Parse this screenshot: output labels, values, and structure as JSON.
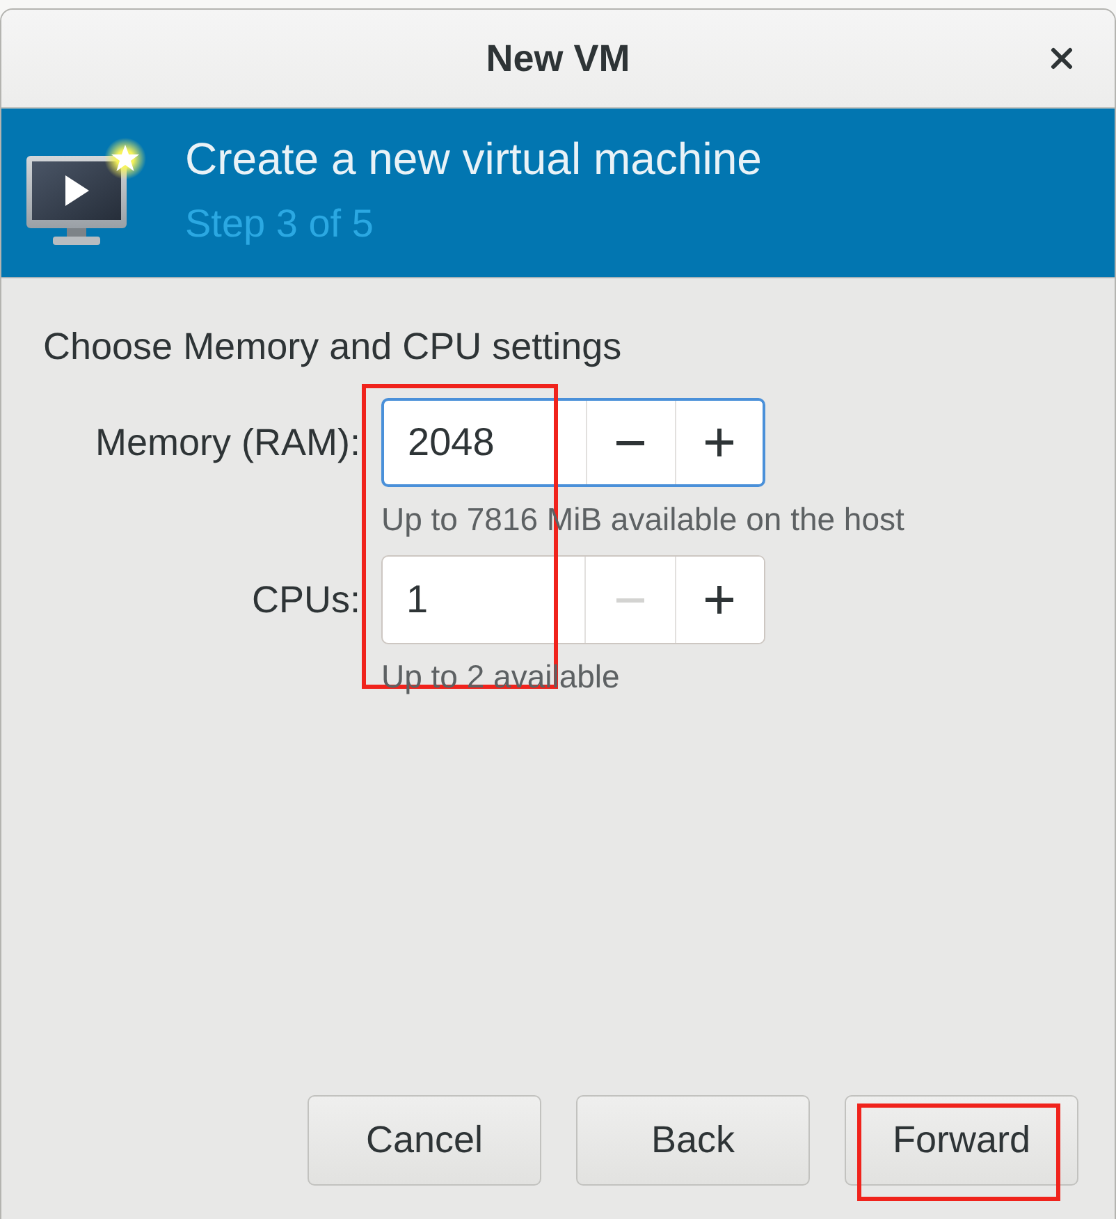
{
  "window": {
    "title": "New VM"
  },
  "banner": {
    "title": "Create a new virtual machine",
    "step": "Step 3 of 5"
  },
  "section": {
    "heading": "Choose Memory and CPU settings"
  },
  "fields": [
    {
      "label": "Memory (RAM):",
      "value": "2048",
      "focused": true,
      "decrement_disabled": false,
      "increment_disabled": false,
      "hint": "Up to 7816 MiB available on the host"
    },
    {
      "label": "CPUs:",
      "value": "1",
      "focused": false,
      "decrement_disabled": true,
      "increment_disabled": false,
      "hint": "Up to 2 available"
    }
  ],
  "buttons": [
    {
      "label": "Cancel"
    },
    {
      "label": "Back"
    },
    {
      "label": "Forward"
    }
  ]
}
